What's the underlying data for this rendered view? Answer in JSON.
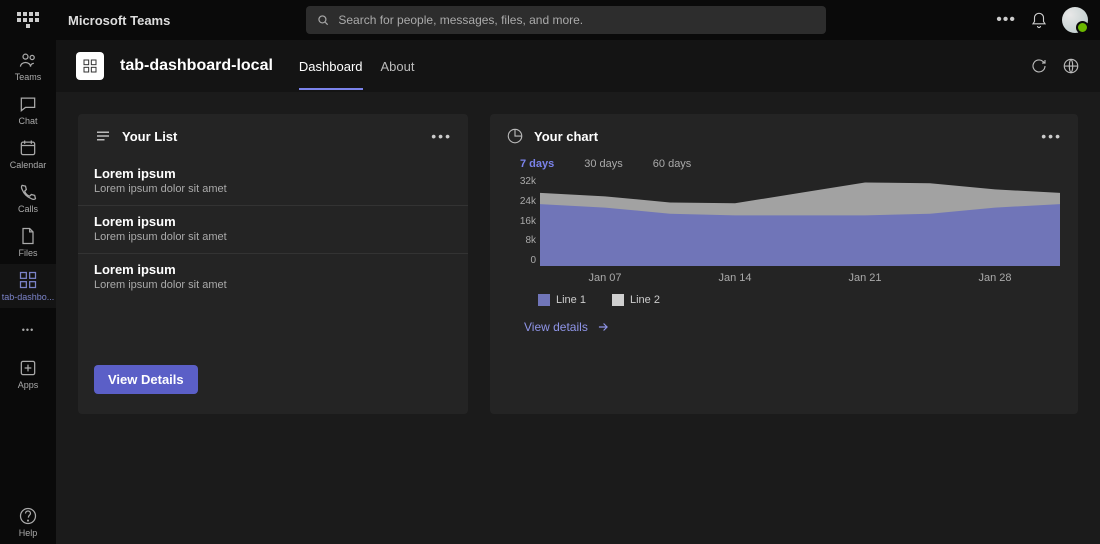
{
  "app": {
    "brand": "Microsoft Teams",
    "search_placeholder": "Search for people, messages, files, and more."
  },
  "rail": {
    "items": [
      {
        "label": "Teams"
      },
      {
        "label": "Chat"
      },
      {
        "label": "Calendar"
      },
      {
        "label": "Calls"
      },
      {
        "label": "Files"
      },
      {
        "label": "tab-dashbo..."
      }
    ],
    "apps_label": "Apps",
    "help_label": "Help"
  },
  "tabhead": {
    "app_name": "tab-dashboard-local",
    "tabs": [
      {
        "label": "Dashboard",
        "active": true
      },
      {
        "label": "About",
        "active": false
      }
    ]
  },
  "list_card": {
    "title": "Your List",
    "rows": [
      {
        "title": "Lorem ipsum",
        "subtitle": "Lorem ipsum dolor sit amet"
      },
      {
        "title": "Lorem ipsum",
        "subtitle": "Lorem ipsum dolor sit amet"
      },
      {
        "title": "Lorem ipsum",
        "subtitle": "Lorem ipsum dolor sit amet"
      }
    ],
    "button": "View Details"
  },
  "chart_card": {
    "title": "Your chart",
    "range_tabs": [
      "7 days",
      "30 days",
      "60 days"
    ],
    "active_range": "7 days",
    "view_details": "View details",
    "legend": {
      "line1": "Line 1",
      "line2": "Line 2"
    }
  },
  "chart_data": {
    "type": "area",
    "x": [
      "Jan 07",
      "Jan 14",
      "Jan 21",
      "Jan 28"
    ],
    "series": [
      {
        "name": "Line 1",
        "color": "#7075b8",
        "values": [
          22000,
          18000,
          18000,
          22000
        ]
      },
      {
        "name": "Line 2",
        "color": "#b8b8b8",
        "values": [
          26000,
          22000,
          30000,
          26000
        ]
      }
    ],
    "ylim": [
      0,
      32000
    ],
    "yticks": [
      "32k",
      "24k",
      "16k",
      "8k",
      "0"
    ],
    "xlabel": "",
    "ylabel": "",
    "title": ""
  }
}
